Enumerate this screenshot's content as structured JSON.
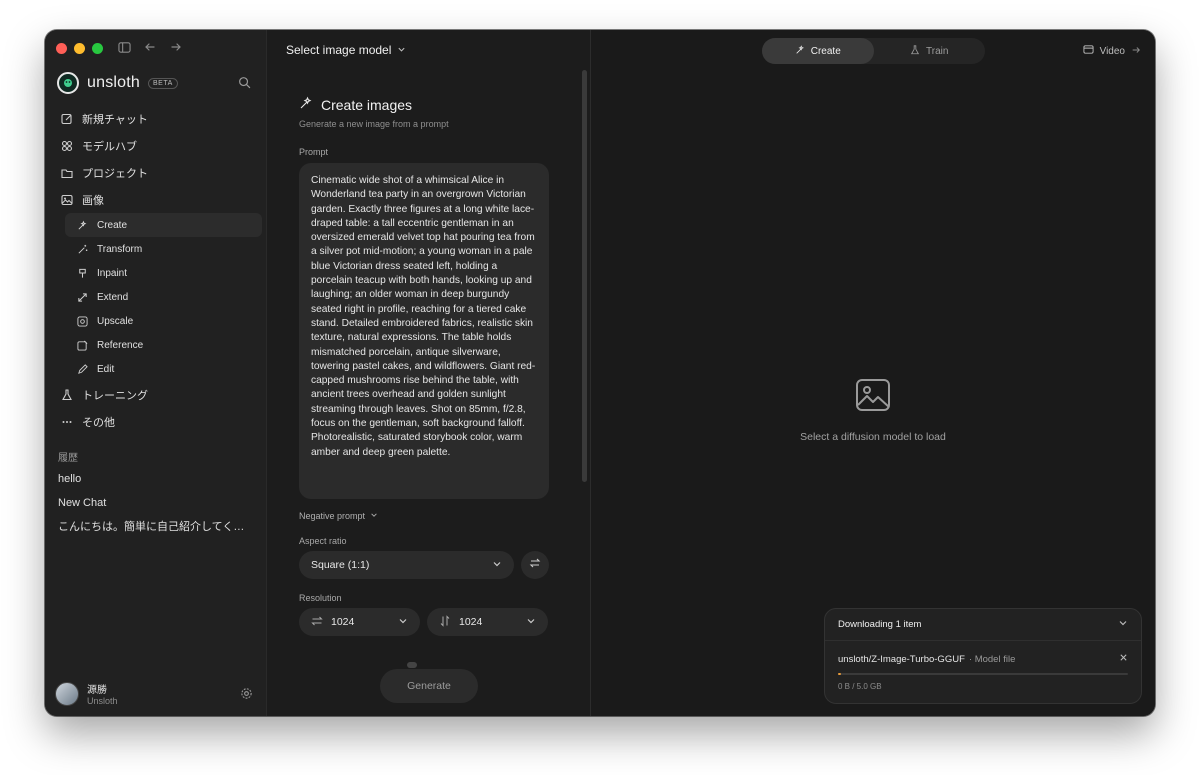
{
  "sidebar": {
    "brand": "unsloth",
    "badge": "BETA",
    "nav": [
      {
        "label": "新規チャット",
        "icon": "edit-icon"
      },
      {
        "label": "モデルハブ",
        "icon": "grid-icon"
      },
      {
        "label": "プロジェクト",
        "icon": "folder-icon"
      },
      {
        "label": "画像",
        "icon": "image-icon"
      }
    ],
    "image_sub": [
      {
        "label": "Create",
        "icon": "sparkle-icon"
      },
      {
        "label": "Transform",
        "icon": "wand-icon"
      },
      {
        "label": "Inpaint",
        "icon": "brush-icon"
      },
      {
        "label": "Extend",
        "icon": "expand-icon"
      },
      {
        "label": "Upscale",
        "icon": "upscale-icon"
      },
      {
        "label": "Reference",
        "icon": "reference-icon"
      },
      {
        "label": "Edit",
        "icon": "pencil-icon"
      }
    ],
    "nav2": [
      {
        "label": "トレーニング",
        "icon": "flask-icon"
      },
      {
        "label": "その他",
        "icon": "more-icon"
      }
    ],
    "history_label": "履歴",
    "history": [
      "hello",
      "New Chat",
      "こんにちは。簡単に自己紹介してください"
    ],
    "user": {
      "name": "源勝",
      "org": "Unsloth"
    }
  },
  "panel": {
    "model_select": "Select image model",
    "title": "Create images",
    "subtitle": "Generate a new image from a prompt",
    "prompt_label": "Prompt",
    "prompt": "Cinematic wide shot of a whimsical Alice in Wonderland tea party in an overgrown Victorian garden. Exactly three figures at a long white lace-draped table: a tall eccentric gentleman in an oversized emerald velvet top hat pouring tea from a silver pot mid-motion; a young woman in a pale blue Victorian dress seated left, holding a porcelain teacup with both hands, looking up and laughing; an older woman in deep burgundy seated right in profile, reaching for a tiered cake stand. Detailed embroidered fabrics, realistic skin texture, natural expressions. The table holds mismatched porcelain, antique silverware, towering pastel cakes, and wildflowers. Giant red-capped mushrooms rise behind the table, with ancient trees overhead and golden sunlight streaming through leaves. Shot on 85mm, f/2.8, focus on the gentleman, soft background falloff. Photorealistic, saturated storybook color, warm amber and deep green palette.",
    "negative_prompt": "Negative prompt",
    "aspect_label": "Aspect ratio",
    "aspect_value": "Square (1:1)",
    "resolution_label": "Resolution",
    "width": "1024",
    "height": "1024",
    "generate": "Generate"
  },
  "main": {
    "tabs": [
      {
        "label": "Create",
        "active": true
      },
      {
        "label": "Train",
        "active": false
      }
    ],
    "video": "Video",
    "empty_text": "Select a diffusion model to load"
  },
  "download": {
    "title": "Downloading 1 item",
    "name": "unsloth/Z-Image-Turbo-GGUF",
    "kind": "· Model file",
    "size": "0 B / 5.0 GB",
    "progress": 0.01
  },
  "colors": {
    "accent_progress": "#e69a3a",
    "traffic_red": "#ff5f57",
    "traffic_yellow": "#febc2e",
    "traffic_green": "#28c840"
  }
}
